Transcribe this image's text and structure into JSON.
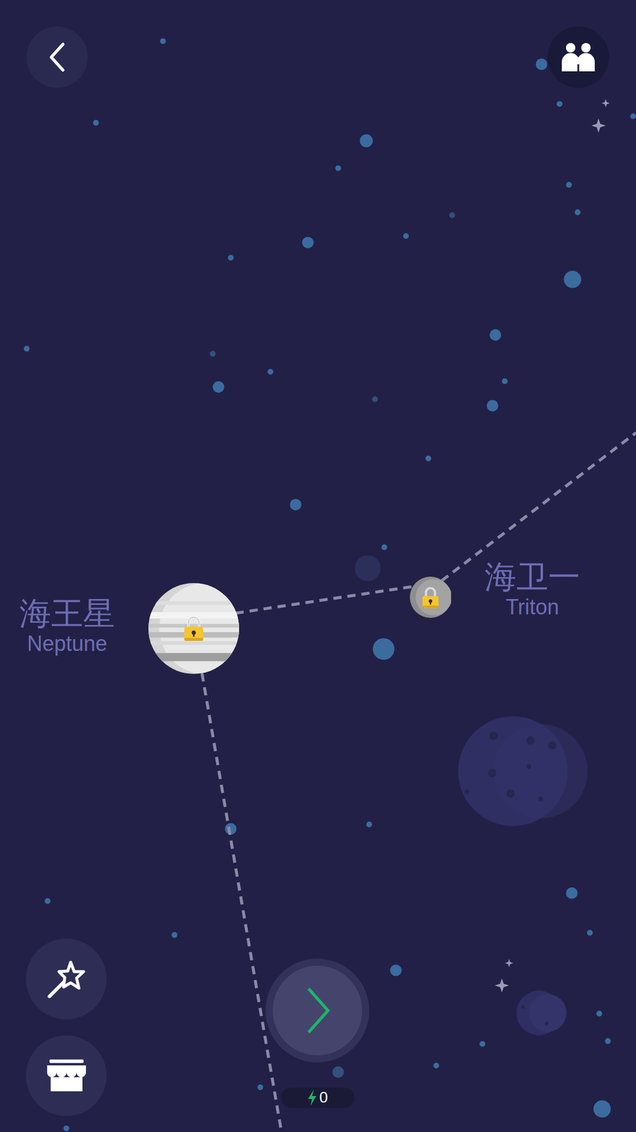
{
  "levels": [
    {
      "name": "海王星",
      "subtitle": "Neptune",
      "locked": true,
      "kind": "planet"
    },
    {
      "name": "海卫一",
      "subtitle": "Triton",
      "locked": true,
      "kind": "moon"
    }
  ],
  "energy": {
    "value": "0"
  }
}
